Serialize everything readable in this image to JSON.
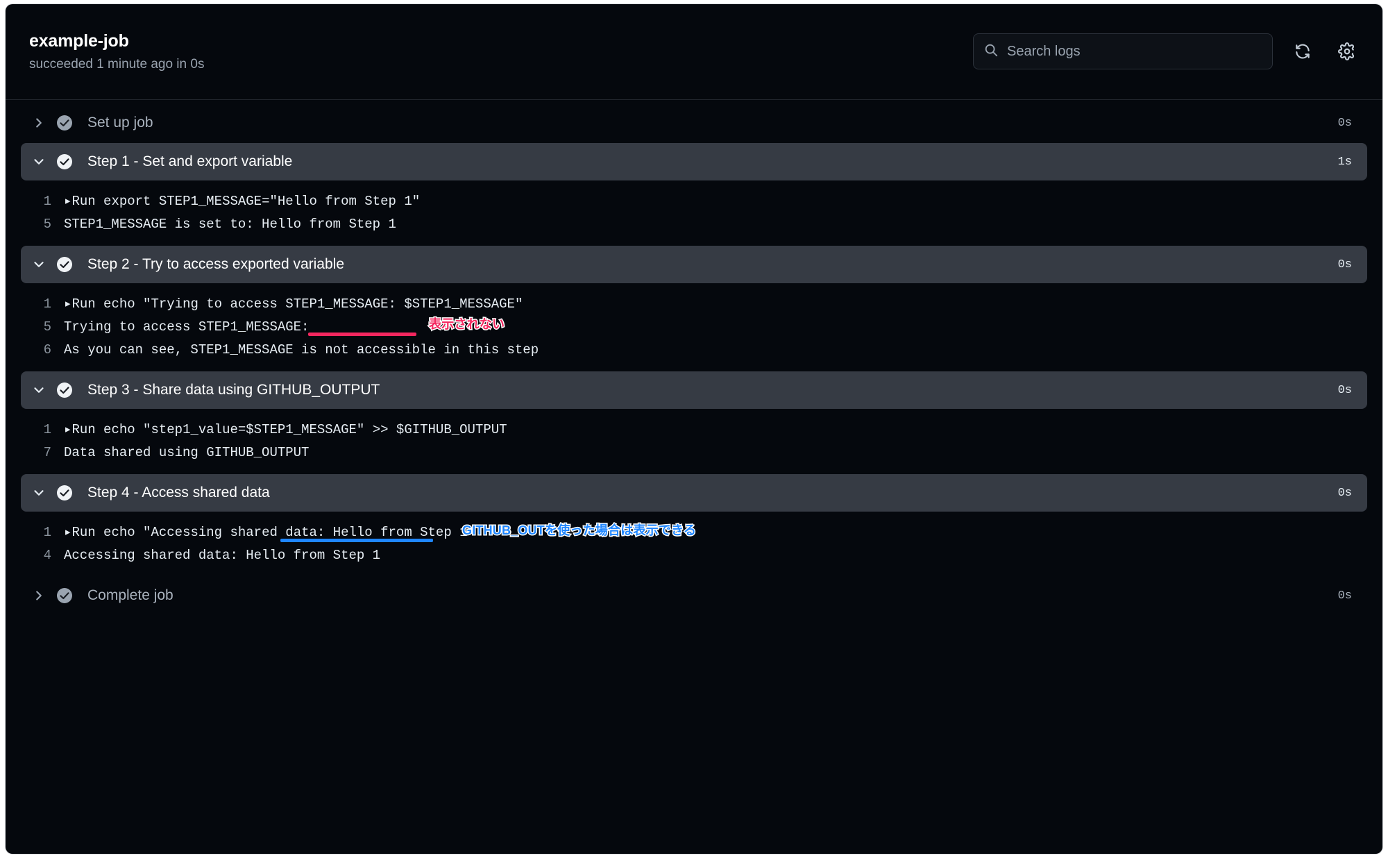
{
  "header": {
    "job_title": "example-job",
    "job_status": "succeeded 1 minute ago in 0s",
    "search_placeholder": "Search logs",
    "search_value": "",
    "refresh_icon": "refresh-icon",
    "settings_icon": "gear-icon"
  },
  "colors": {
    "page_bg": "#05080d",
    "expanded_row_bg": "#363b44",
    "text_primary": "#ffffff",
    "text_muted": "#a9b2bd",
    "annotation_pink": "#f4275f",
    "annotation_blue": "#1f86ff"
  },
  "steps": [
    {
      "name": "Set up job",
      "duration": "0s",
      "expanded": false,
      "status": "success",
      "chevron": "chevron-right-icon",
      "lines": []
    },
    {
      "name": "Step 1 - Set and export variable",
      "duration": "1s",
      "expanded": true,
      "status": "success",
      "chevron": "chevron-down-icon",
      "lines": [
        {
          "number": "1",
          "text": "▸Run export STEP1_MESSAGE=\"Hello from Step 1\""
        },
        {
          "number": "5",
          "text": "STEP1_MESSAGE is set to: Hello from Step 1"
        }
      ]
    },
    {
      "name": "Step 2 - Try to access exported variable",
      "duration": "0s",
      "expanded": true,
      "status": "success",
      "chevron": "chevron-down-icon",
      "lines": [
        {
          "number": "1",
          "text": "▸Run echo \"Trying to access STEP1_MESSAGE: $STEP1_MESSAGE\""
        },
        {
          "number": "5",
          "text": "Trying to access STEP1_MESSAGE:"
        },
        {
          "number": "6",
          "text": "As you can see, STEP1_MESSAGE is not accessible in this step"
        }
      ],
      "annotation": {
        "label": "表示されない",
        "color": "pink"
      }
    },
    {
      "name": "Step 3 - Share data using GITHUB_OUTPUT",
      "duration": "0s",
      "expanded": true,
      "status": "success",
      "chevron": "chevron-down-icon",
      "lines": [
        {
          "number": "1",
          "text": "▸Run echo \"step1_value=$STEP1_MESSAGE\" >> $GITHUB_OUTPUT"
        },
        {
          "number": "7",
          "text": "Data shared using GITHUB_OUTPUT"
        }
      ]
    },
    {
      "name": "Step 4 - Access shared data",
      "duration": "0s",
      "expanded": true,
      "status": "success",
      "chevron": "chevron-down-icon",
      "lines": [
        {
          "number": "1",
          "text": "▸Run echo \"Accessing shared data: Hello from Step 1\""
        },
        {
          "number": "4",
          "text": "Accessing shared data: Hello from Step 1"
        }
      ],
      "annotation": {
        "label": "GITHUB_OUTを使った場合は表示できる",
        "color": "blue"
      }
    },
    {
      "name": "Complete job",
      "duration": "0s",
      "expanded": false,
      "status": "success",
      "chevron": "chevron-right-icon",
      "lines": []
    }
  ]
}
